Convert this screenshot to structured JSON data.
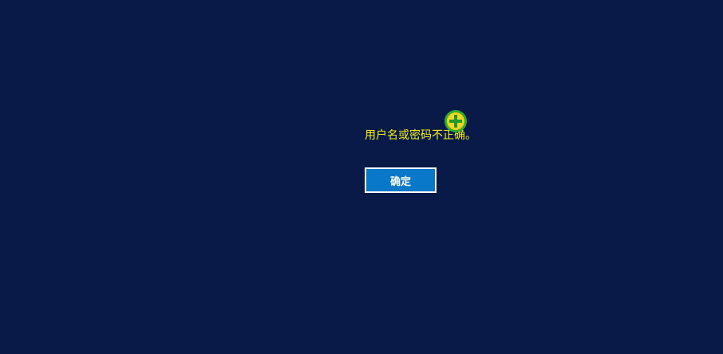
{
  "dialog": {
    "message": "用户名或密码不正确。",
    "ok_label": "确定",
    "badge_icon": "plus-circle-icon"
  },
  "colors": {
    "background": "#0a1a48",
    "message_text": "#f3f01a",
    "button_fill": "#0a78c8",
    "button_border": "#ffffff",
    "badge_ring": "#2fae2f",
    "badge_fill": "#f2d21a"
  }
}
